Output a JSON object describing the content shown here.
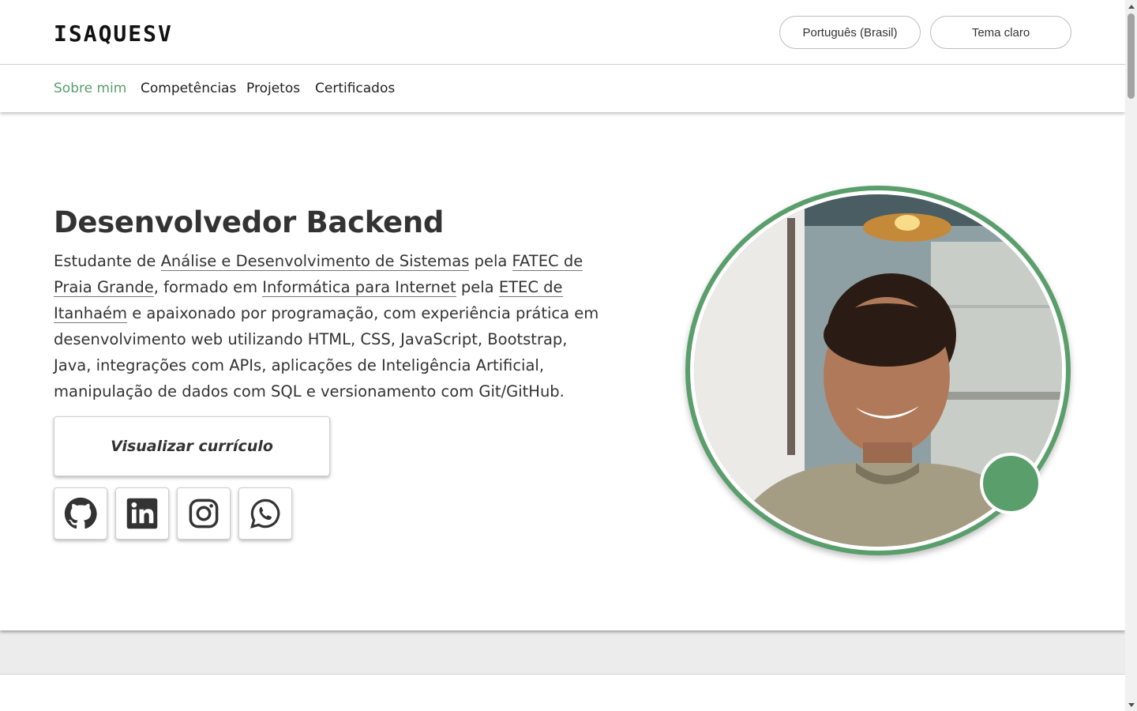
{
  "header": {
    "brand": "ISAQUESV",
    "language_button": "Português (Brasil)",
    "theme_button": "Tema claro"
  },
  "nav": {
    "items": [
      {
        "label": "Sobre mim",
        "active": true
      },
      {
        "label": "Competências",
        "active": false
      },
      {
        "label": "Projetos",
        "active": false
      },
      {
        "label": "Certificados",
        "active": false
      }
    ]
  },
  "hero": {
    "title": "Desenvolvedor Backend",
    "bio": {
      "t1": "Estudante de ",
      "link1": "Análise e Desenvolvimento de Sistemas",
      "t2": " pela ",
      "link2": "FATEC de Praia Grande",
      "t3": ", formado em ",
      "link3": "Informática para Internet",
      "t4": " pela ",
      "link4": "ETEC de Itanhaém",
      "t5": " e apaixonado por programação, com experiência prática em desenvolvimento web utilizando HTML, CSS, JavaScript, Bootstrap, Java, integrações com APIs, aplicações de Inteligência Artificial, manipulação de dados com SQL e versionamento com Git/GitHub."
    },
    "cv_button": "Visualizar currículo",
    "social": [
      "github-icon",
      "linkedin-icon",
      "instagram-icon",
      "whatsapp-icon"
    ]
  },
  "colors": {
    "accent": "#5a9e6c",
    "text": "#333333",
    "band": "#ececec"
  }
}
